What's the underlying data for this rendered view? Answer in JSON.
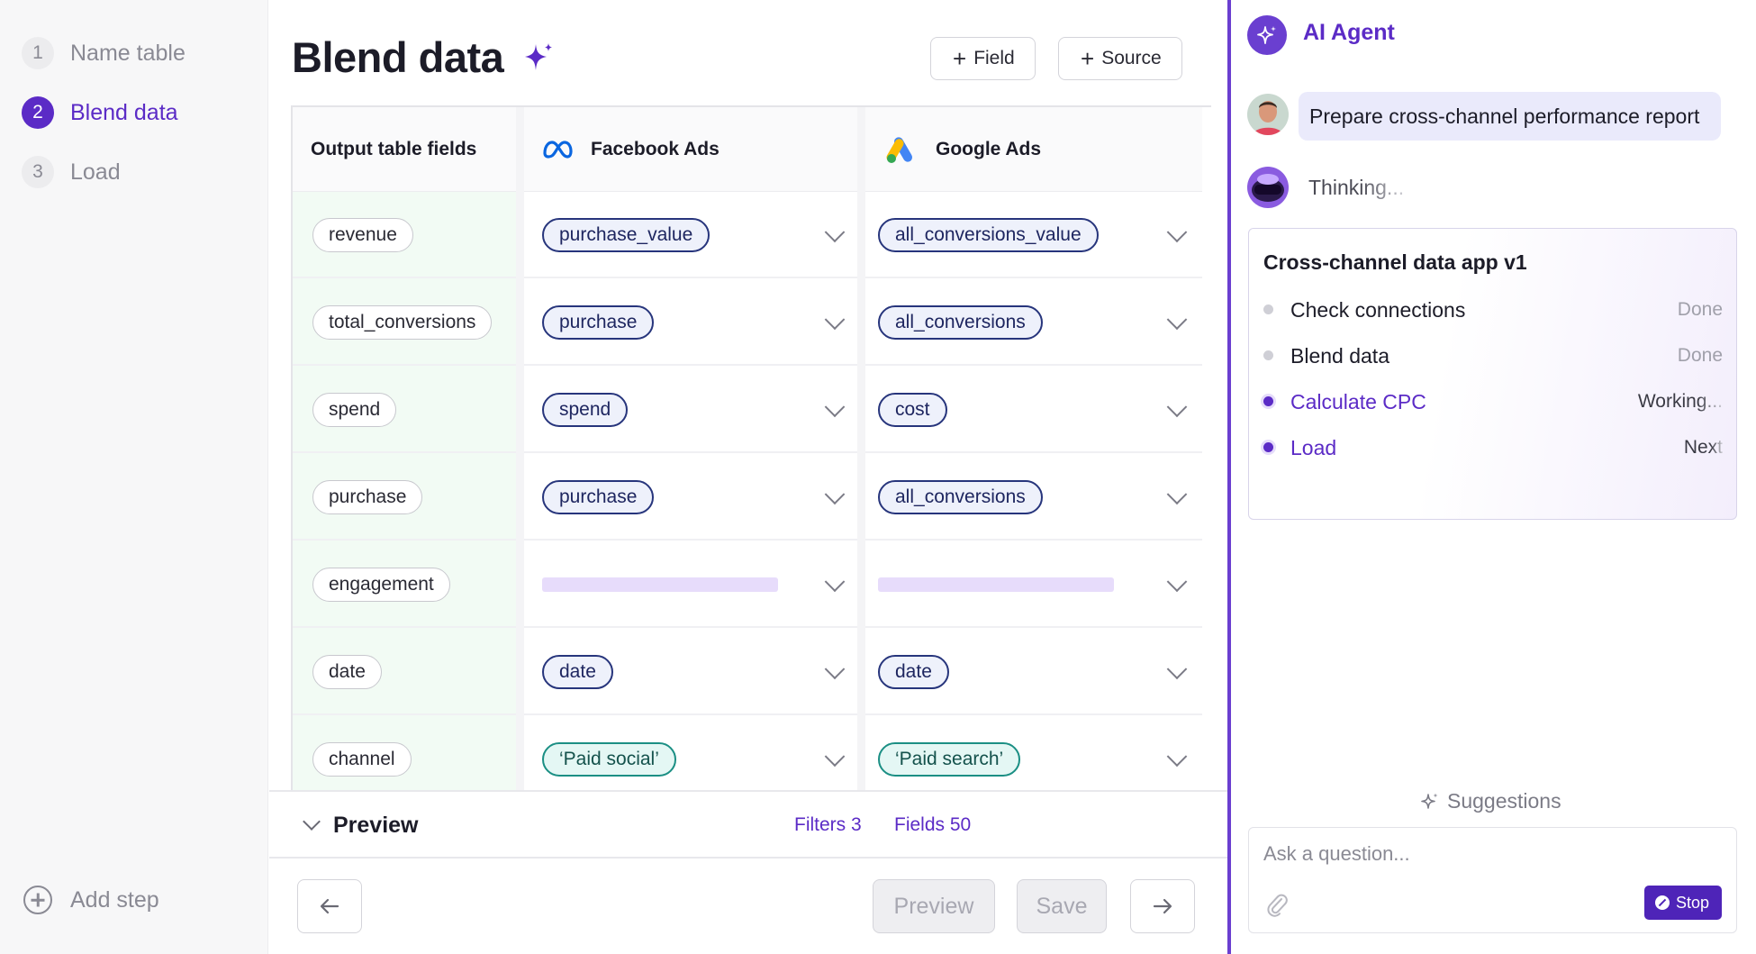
{
  "steps": [
    {
      "num": "1",
      "label": "Name table"
    },
    {
      "num": "2",
      "label": "Blend data"
    },
    {
      "num": "3",
      "label": "Load"
    }
  ],
  "add_step_label": "Add step",
  "main": {
    "title": "Blend data",
    "field_button": "Field",
    "source_button": "Source"
  },
  "table": {
    "headers": {
      "output": "Output table fields",
      "facebook": "Facebook Ads",
      "google": "Google Ads"
    },
    "rows": [
      {
        "output": "revenue",
        "facebook": "purchase_value",
        "google": "all_conversions_value",
        "type": "map"
      },
      {
        "output": "total_conversions",
        "facebook": "purchase",
        "google": "all_conversions",
        "type": "map"
      },
      {
        "output": "spend",
        "facebook": "spend",
        "google": "cost",
        "type": "map"
      },
      {
        "output": "purchase",
        "facebook": "purchase",
        "google": "all_conversions",
        "type": "map"
      },
      {
        "output": "engagement",
        "facebook": "",
        "google": "",
        "type": "empty"
      },
      {
        "output": "date",
        "facebook": "date",
        "google": "date",
        "type": "map"
      },
      {
        "output": "channel",
        "facebook": "‘Paid social’",
        "google": "‘Paid search’",
        "type": "const"
      }
    ]
  },
  "preview_bar": {
    "title": "Preview",
    "filters": "Filters 3",
    "fields": "Fields 50"
  },
  "footer": {
    "preview_button": "Preview",
    "save_button": "Save"
  },
  "agent": {
    "title": "AI Agent",
    "user_message": "Prepare cross-channel performance report",
    "status": "Thinking...",
    "plan": {
      "title": "Cross-channel data app v1",
      "items": [
        {
          "label": "Check connections",
          "status": "Done",
          "active": false
        },
        {
          "label": "Blend data",
          "status": "Done",
          "active": false
        },
        {
          "label": "Calculate CPC",
          "status": "Working...",
          "active": true
        },
        {
          "label": "Load",
          "status": "Next",
          "active": true
        }
      ]
    },
    "suggestions_label": "Suggestions",
    "input_placeholder": "Ask a question...",
    "stop_button": "Stop"
  },
  "colors": {
    "accent": "#5b2bc6",
    "mapped_chip_border": "#27357c",
    "constant_chip_border": "#1b8f84",
    "output_column_bg": "#f2fbf4"
  }
}
